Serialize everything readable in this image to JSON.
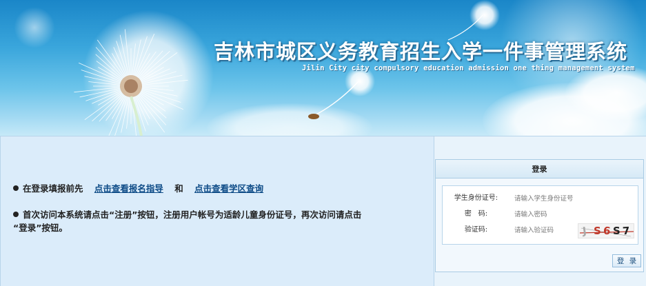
{
  "banner": {
    "title": "吉林市城区义务教育招生入学一件事管理系统",
    "subtitle": "Jilin City city compulsory education admission one thing management system"
  },
  "notices": {
    "line1_prefix": "在登录填报前先",
    "link_guide": "点击查看报名指导",
    "line1_and": "和",
    "link_district": "点击查看学区查询",
    "line2": "首次访问本系统请点击“注册”按钮，注册用户帐号为适龄儿童身份证号，再次访问请点击",
    "line3": "“登录”按钮。"
  },
  "login": {
    "header": "登录",
    "id_label": "学生身份证号:",
    "id_placeholder": "请输入学生身份证号",
    "password_label": "密　码:",
    "password_placeholder": "请输入密码",
    "captcha_label": "验证码:",
    "captcha_placeholder": "请输入验证码",
    "captcha_text": [
      "J",
      "S",
      "6",
      "S",
      "7"
    ],
    "button_label": "登 录"
  }
}
